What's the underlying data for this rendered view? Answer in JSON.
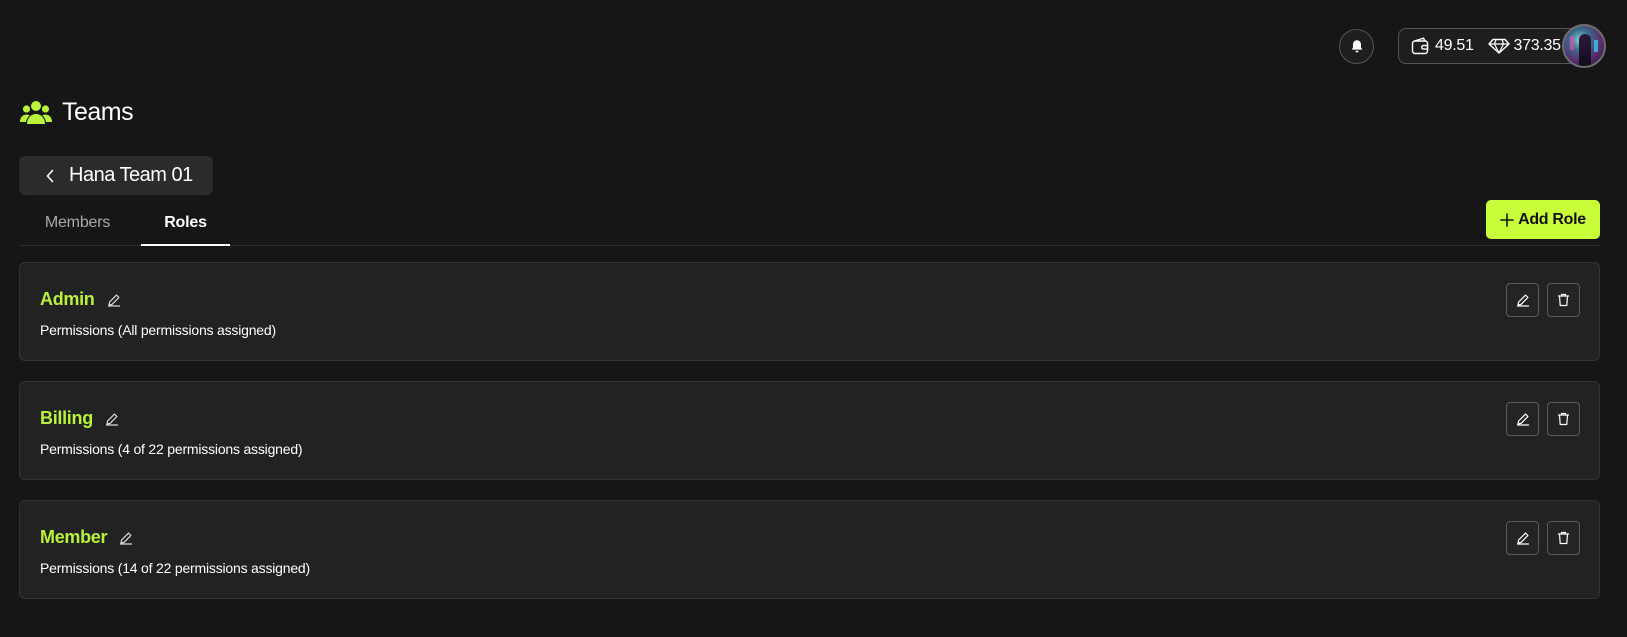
{
  "header": {
    "wallet_balance": "49.51",
    "gems_balance": "373.35"
  },
  "page": {
    "title": "Teams",
    "team_name": "Hana Team 01"
  },
  "tabs": [
    {
      "label": "Members",
      "active": false
    },
    {
      "label": "Roles",
      "active": true
    }
  ],
  "add_role_label": "Add Role",
  "roles": [
    {
      "name": "Admin",
      "permissions": "Permissions (All permissions assigned)"
    },
    {
      "name": "Billing",
      "permissions": "Permissions (4 of 22 permissions assigned)"
    },
    {
      "name": "Member",
      "permissions": "Permissions (14 of 22 permissions assigned)"
    }
  ],
  "colors": {
    "accent": "#c8ff3a",
    "role_name": "#b9f23a",
    "background": "#161616",
    "card": "#222222"
  },
  "icons": {
    "notification": "bell-icon",
    "wallet": "wallet-icon",
    "gems": "diamond-icon",
    "title": "users-icon",
    "back": "chevron-left-icon",
    "add": "plus-icon",
    "edit": "pencil-icon",
    "delete": "trash-icon"
  }
}
